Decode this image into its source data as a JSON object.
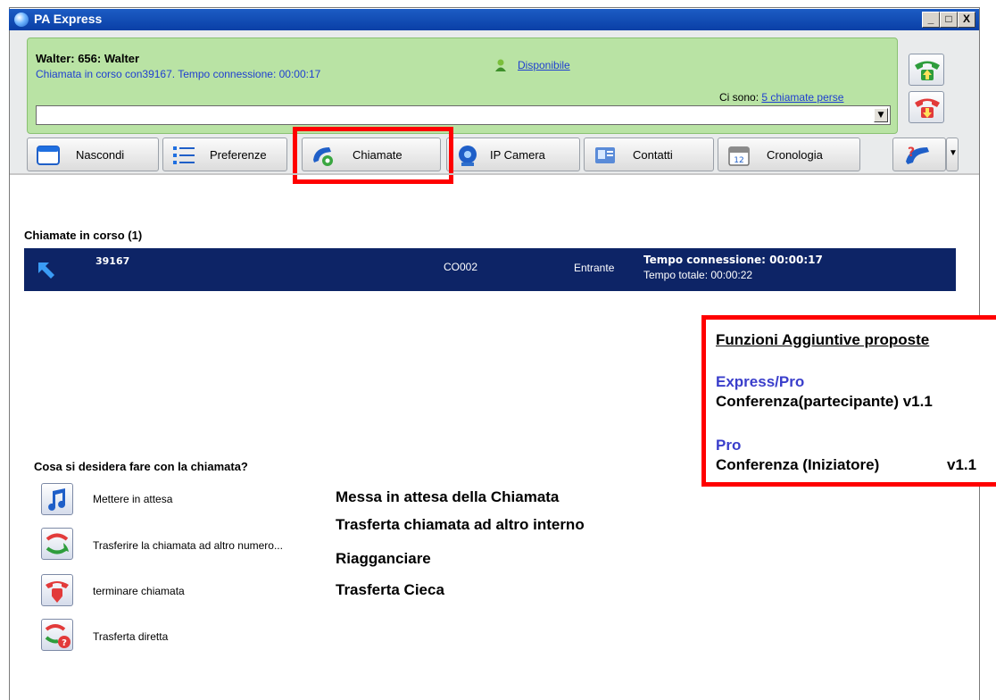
{
  "window": {
    "title": "PA Express",
    "min": "_",
    "max": "□",
    "close": "X"
  },
  "header": {
    "user": "Walter: 656: Walter",
    "call_status": "Chiamata in corso con39167. Tempo connessione: 00:00:17",
    "presence": "Disponibile",
    "missed_prefix": "Ci sono:",
    "missed_link": "5 chiamate perse",
    "combo_value": ""
  },
  "tabs": [
    {
      "label": "Nascondi",
      "icon": "window-icon"
    },
    {
      "label": "Preferenze",
      "icon": "list-icon"
    },
    {
      "label": "Chiamate",
      "icon": "phone-gear-icon"
    },
    {
      "label": "IP Camera",
      "icon": "camera-icon"
    },
    {
      "label": "Contatti",
      "icon": "contacts-icon"
    },
    {
      "label": "Cronologia",
      "icon": "calendar-icon"
    }
  ],
  "calls": {
    "section_title": "Chiamate in corso  (1)",
    "row": {
      "number": "39167",
      "code": "CO002",
      "direction": "Entrante",
      "connection_time": "Tempo connessione: 00:00:17",
      "total_time": "Tempo totale: 00:00:22"
    }
  },
  "actions": {
    "question": "Cosa si desidera fare con la chiamata?",
    "items": [
      {
        "label": "Mettere in attesa",
        "icon": "music-note-icon"
      },
      {
        "label": "Trasferire la chiamata ad altro numero...",
        "icon": "transfer-icon"
      },
      {
        "label": "terminare chiamata",
        "icon": "hangup-icon"
      },
      {
        "label": "Trasferta diretta",
        "icon": "transfer-help-icon"
      }
    ]
  },
  "descriptions": [
    "Messa in attesa della Chiamata",
    "Trasferta chiamata ad altro interno",
    "Riagganciare",
    "Trasferta Cieca"
  ],
  "panel": {
    "title": "Funzioni Aggiuntive proposte",
    "group1_title": "Express/Pro",
    "group1_item": "Conferenza(partecipante) v1.1",
    "group2_title": "Pro",
    "group2_item_name": "Conferenza (Iniziatore)",
    "group2_item_version": "v1.1"
  },
  "colors": {
    "highlight": "#ff0000",
    "call_row": "#0d2466",
    "green_panel": "#b9e3a4",
    "link": "#1f3fd0",
    "panel_blue": "#3a3ecb"
  }
}
